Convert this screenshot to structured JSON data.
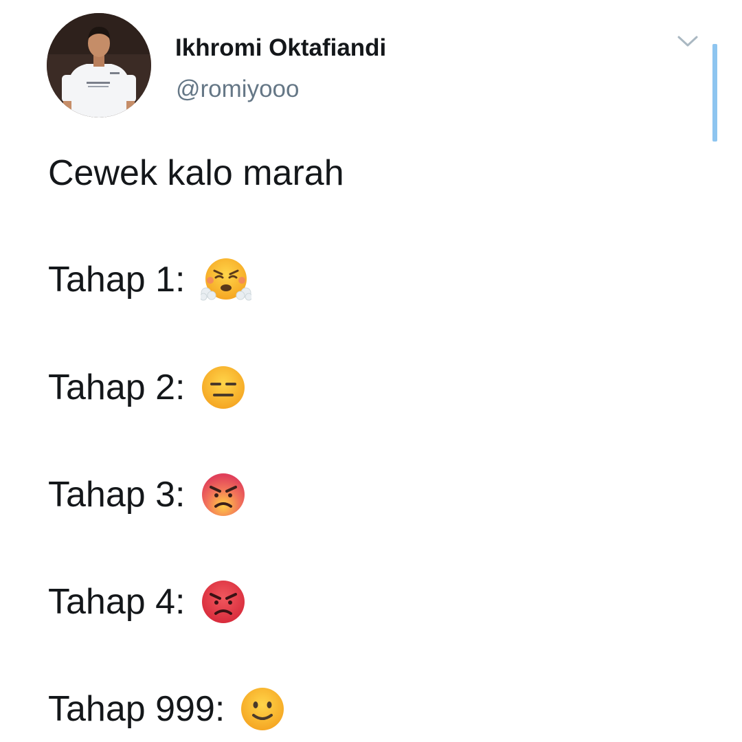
{
  "tweet": {
    "author": {
      "display_name": "Ikhromi Oktafiandi",
      "handle": "@romiyooo"
    },
    "text": {
      "intro": "Cewek kalo marah",
      "stages": [
        {
          "label": "Tahap 1:",
          "emoji": "face-with-steam-from-nose"
        },
        {
          "label": "Tahap 2:",
          "emoji": "expressionless-face"
        },
        {
          "label": "Tahap 3:",
          "emoji": "angry-face"
        },
        {
          "label": "Tahap 4:",
          "emoji": "pouting-face"
        },
        {
          "label": "Tahap 999:",
          "emoji": "slightly-smiling-face"
        }
      ]
    }
  },
  "icons": {
    "menu": "chevron-down-icon"
  },
  "colors": {
    "handle": "#657786",
    "scrollbar": "#8ec5f0",
    "emoji_yellow": "#fdb830",
    "emoji_red": "#e6394a"
  }
}
